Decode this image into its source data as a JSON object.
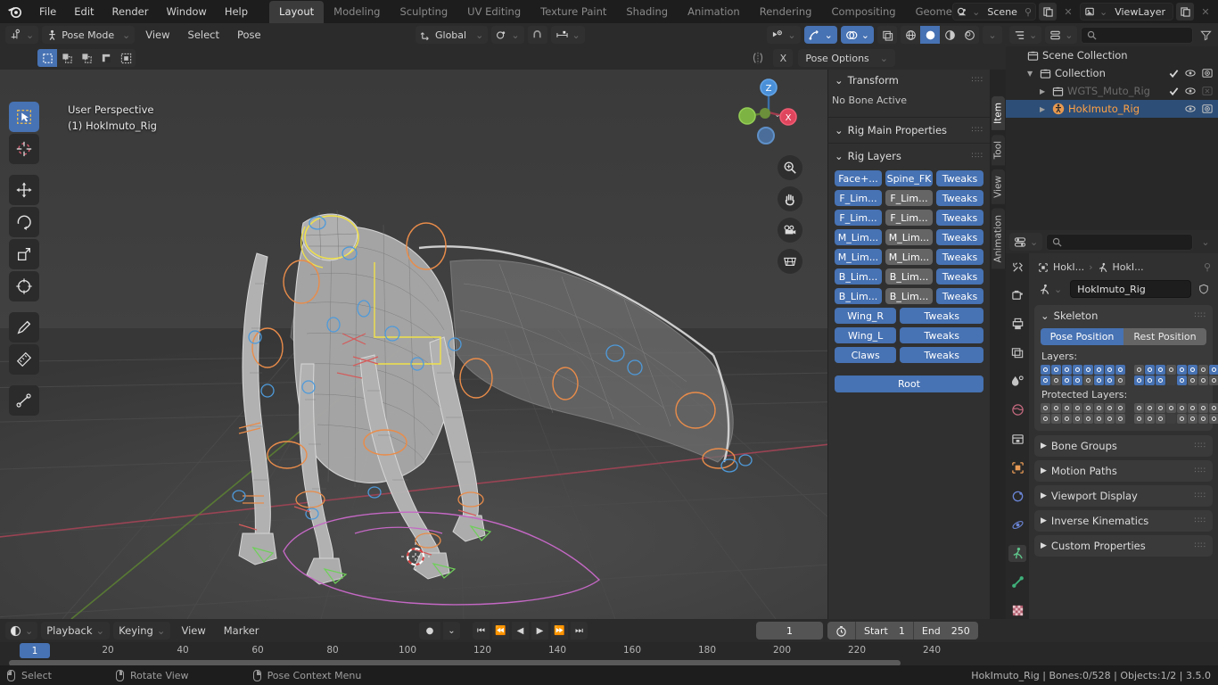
{
  "app": {
    "name": "Blender",
    "version": "3.5.0"
  },
  "topbar": {
    "menus": [
      "File",
      "Edit",
      "Render",
      "Window",
      "Help"
    ],
    "workspaces": [
      {
        "label": "Layout",
        "active": true
      },
      {
        "label": "Modeling",
        "active": false
      },
      {
        "label": "Sculpting",
        "active": false
      },
      {
        "label": "UV Editing",
        "active": false
      },
      {
        "label": "Texture Paint",
        "active": false
      },
      {
        "label": "Shading",
        "active": false
      },
      {
        "label": "Animation",
        "active": false
      },
      {
        "label": "Rendering",
        "active": false
      },
      {
        "label": "Compositing",
        "active": false
      },
      {
        "label": "Geometry Noc",
        "active": false
      }
    ],
    "scene_value": "Scene",
    "viewlayer_value": "ViewLayer"
  },
  "viewport": {
    "mode": "Pose Mode",
    "menus": [
      "View",
      "Select",
      "Pose"
    ],
    "transform_orientation": "Global",
    "overlay_text_line1": "User Perspective",
    "overlay_text_line2": "(1) HokImuto_Rig",
    "pose_options_label": "Pose Options",
    "x_label": "X",
    "gizmo_axes": {
      "z": "Z",
      "x": "X"
    },
    "nav_icons": [
      "zoom-icon",
      "hand-icon",
      "camera-icon",
      "grid-icon"
    ],
    "tool_icons": [
      "tweak-select-icon",
      "cursor-icon",
      "move-icon",
      "rotate-icon",
      "scale-icon",
      "transform-icon",
      "annotate-icon",
      "measure-icon",
      "bone-icon"
    ]
  },
  "npanel": {
    "tabs": [
      {
        "label": "Item",
        "active": true
      },
      {
        "label": "Tool",
        "active": false
      },
      {
        "label": "View",
        "active": false
      },
      {
        "label": "Animation",
        "active": false
      }
    ],
    "transform_title": "Transform",
    "no_bone_active": "No Bone Active",
    "rig_main_title": "Rig Main Properties",
    "rig_layers_title": "Rig Layers",
    "rig_layer_rows": [
      [
        {
          "label": "Face+...",
          "style": "blue"
        },
        {
          "label": "Spine_FK",
          "style": "blue"
        },
        {
          "label": "Tweaks",
          "style": "blue"
        }
      ],
      [
        {
          "label": "F_Lim...",
          "style": "blue"
        },
        {
          "label": "F_Lim...",
          "style": "grey"
        },
        {
          "label": "Tweaks",
          "style": "blue"
        }
      ],
      [
        {
          "label": "F_Lim...",
          "style": "blue"
        },
        {
          "label": "F_Lim...",
          "style": "grey"
        },
        {
          "label": "Tweaks",
          "style": "blue"
        }
      ],
      [
        {
          "label": "M_Lim...",
          "style": "blue"
        },
        {
          "label": "M_Lim...",
          "style": "grey"
        },
        {
          "label": "Tweaks",
          "style": "blue"
        }
      ],
      [
        {
          "label": "M_Lim...",
          "style": "blue"
        },
        {
          "label": "M_Lim...",
          "style": "grey"
        },
        {
          "label": "Tweaks",
          "style": "blue"
        }
      ],
      [
        {
          "label": "B_Lim...",
          "style": "blue"
        },
        {
          "label": "B_Lim...",
          "style": "grey"
        },
        {
          "label": "Tweaks",
          "style": "blue"
        }
      ],
      [
        {
          "label": "B_Lim...",
          "style": "blue"
        },
        {
          "label": "B_Lim...",
          "style": "grey"
        },
        {
          "label": "Tweaks",
          "style": "blue"
        }
      ],
      [
        {
          "label": "Wing_R",
          "style": "blue"
        },
        {
          "label": "Tweaks",
          "style": "blue"
        }
      ],
      [
        {
          "label": "Wing_L",
          "style": "blue"
        },
        {
          "label": "Tweaks",
          "style": "blue"
        }
      ],
      [
        {
          "label": "Claws",
          "style": "blue"
        },
        {
          "label": "Tweaks",
          "style": "blue"
        }
      ]
    ],
    "root_label": "Root"
  },
  "outliner": {
    "search_placeholder": "",
    "rows": [
      {
        "label": "Scene Collection",
        "depth": 0,
        "icon": "collection-icon",
        "selected": false,
        "has_arrow": false,
        "checkbox": null,
        "eye": false,
        "camera": false
      },
      {
        "label": "Collection",
        "depth": 1,
        "icon": "collection-icon",
        "selected": false,
        "has_arrow": true,
        "arrow_open": true,
        "checkbox": true,
        "eye": true,
        "camera": true
      },
      {
        "label": "WGTS_Muto_Rig",
        "depth": 2,
        "icon": "collection-icon",
        "selected": false,
        "has_arrow": true,
        "arrow_open": false,
        "checkbox": true,
        "eye": true,
        "camera": "disabled",
        "dim": true
      },
      {
        "label": "HokImuto_Rig",
        "depth": 2,
        "icon": "armature-icon",
        "selected": true,
        "has_arrow": true,
        "arrow_open": false,
        "checkbox": null,
        "eye": true,
        "camera": true
      }
    ]
  },
  "properties": {
    "breadcrumb": [
      "HokI...",
      "HokI..."
    ],
    "id_name": "HokImuto_Rig",
    "skeleton_title": "Skeleton",
    "pose_position_label": "Pose Position",
    "rest_position_label": "Rest Position",
    "pose_position_active": true,
    "layers_label": "Layers:",
    "protected_layers_label": "Protected Layers:",
    "layers_state": {
      "top_left": [
        1,
        1,
        1,
        1,
        1,
        1,
        1,
        1
      ],
      "top_right": [
        0,
        1,
        1,
        0,
        1,
        1,
        0,
        1
      ],
      "bot_left": [
        1,
        0,
        1,
        1,
        0,
        1,
        1,
        0
      ],
      "bot_right": [
        1,
        1,
        1,
        -1,
        1,
        0,
        0,
        0
      ]
    },
    "protected_state": {
      "top_left": [
        0,
        0,
        0,
        0,
        0,
        0,
        0,
        0
      ],
      "top_right": [
        0,
        0,
        0,
        0,
        0,
        0,
        0,
        0
      ],
      "bot_left": [
        0,
        0,
        0,
        0,
        0,
        0,
        0,
        0
      ],
      "bot_right": [
        0,
        0,
        0,
        -1,
        0,
        0,
        0,
        0
      ]
    },
    "closed_panels": [
      "Bone Groups",
      "Motion Paths",
      "Viewport Display",
      "Inverse Kinematics",
      "Custom Properties"
    ],
    "tab_icons": [
      "tool-icon",
      "render-icon",
      "output-icon",
      "viewlayer-icon",
      "scene-icon",
      "world-icon",
      "collection-icon",
      "object-icon",
      "modifier-icon",
      "physics-icon",
      "armature-data-icon",
      "bone-icon",
      "texture-icon"
    ]
  },
  "timeline": {
    "menus": [
      "View",
      "Marker"
    ],
    "playback_label": "Playback",
    "keying_label": "Keying",
    "current_frame": "1",
    "start_label": "Start",
    "start_value": "1",
    "end_label": "End",
    "end_value": "250",
    "playhead_label": "1",
    "ticks": [
      "20",
      "40",
      "60",
      "80",
      "100",
      "120",
      "140",
      "160",
      "180",
      "200",
      "220",
      "240"
    ]
  },
  "statusbar": {
    "hints": [
      {
        "mouse": "left",
        "label": "Select"
      },
      {
        "mouse": "middle",
        "label": "Rotate View"
      },
      {
        "mouse": "right",
        "label": "Pose Context Menu"
      }
    ],
    "info": "HokImuto_Rig | Bones:0/528 | Objects:1/2 | 3.5.0"
  },
  "colors": {
    "accent_blue": "#4772b3",
    "selected_orange": "#ffa144",
    "panel_bg": "#303030",
    "header_bg": "#2b2b2b"
  }
}
